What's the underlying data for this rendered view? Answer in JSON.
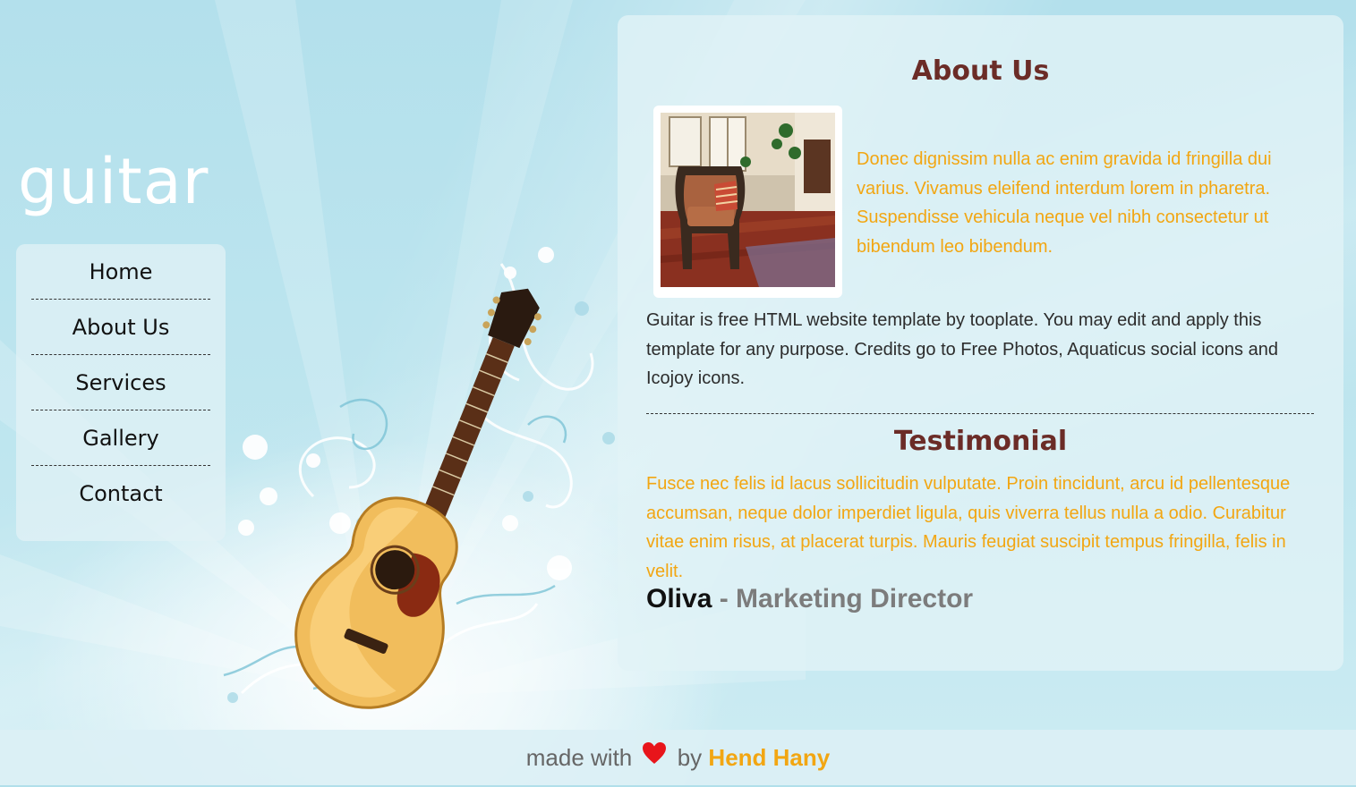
{
  "site": {
    "logo": "guitar"
  },
  "nav": {
    "items": [
      {
        "label": "Home"
      },
      {
        "label": "About Us"
      },
      {
        "label": "Services"
      },
      {
        "label": "Gallery"
      },
      {
        "label": "Contact"
      }
    ]
  },
  "about": {
    "title": "About Us",
    "image": "armchair-room-photo",
    "highlight": "Donec dignissim nulla ac enim gravida id fringilla dui varius. Vivamus eleifend interdum lorem in pharetra. Suspendisse vehicula neque vel nibh consectetur ut bibendum leo bibendum.",
    "body": "Guitar is free HTML website template by tooplate. You may edit and apply this template for any purpose. Credits go to Free Photos, Aquaticus social icons and Icojoy icons."
  },
  "testimonial": {
    "title": "Testimonial",
    "text": "Fusce nec felis id lacus sollicitudin vulputate. Proin tincidunt, arcu id pellentesque accumsan, neque dolor imperdiet ligula, quis viverra tellus nulla a odio. Curabitur vitae enim risus, at placerat turpis. Mauris feugiat suscipit tempus fringilla, felis in velit.",
    "author_name": "Oliva",
    "separator": " - ",
    "author_role": "Marketing Director"
  },
  "footer": {
    "prefix": "made with",
    "icon": "heart-icon",
    "by": "by",
    "author": "Hend Hany"
  },
  "colors": {
    "background": "#b1dfea",
    "heading": "#6b2c27",
    "accent": "#f2a612",
    "heart": "#e8151b"
  }
}
